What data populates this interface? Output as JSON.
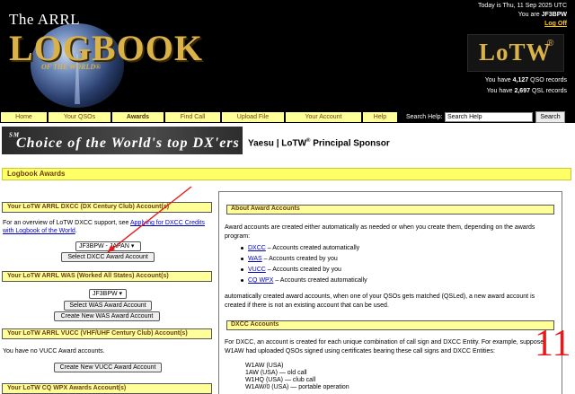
{
  "header": {
    "logo_line1": "The ARRL",
    "logo_line2": "LOGBOOK",
    "logo_line3": "OF THE WORLD®",
    "date_line": "Today is Thu, 11 Sep 2025 UTC",
    "you_are_prefix": "You are",
    "callsign": "JF3BPW",
    "logoff": "Log Off",
    "lotw_logo": "LoTW",
    "lotw_reg": "®",
    "qso_prefix": "You have",
    "qso_count": "4,127",
    "qso_suffix": "QSO records",
    "qsl_prefix": "You have",
    "qsl_count": "2,697",
    "qsl_suffix": "QSL records"
  },
  "nav": {
    "items": [
      "Home",
      "Your QSOs",
      "Awards",
      "Find Call",
      "Upload File",
      "Your Account",
      "Help"
    ],
    "search_label": "Search Help:",
    "search_value": "Search Help",
    "search_button": "Search"
  },
  "banner": {
    "tagline": "Choice of the World's top DX'ers",
    "tagline_sm": "SM",
    "sponsor_prefix": "Yaesu | LoTW",
    "sponsor_reg": "®",
    "sponsor_suffix": " Principal Sponsor"
  },
  "page": {
    "title": "Logbook Awards"
  },
  "left": {
    "dxcc_header": "Your LoTW ARRL DXCC (DX Century Club) Account(s)",
    "dxcc_text_prefix": "For an overview of LoTW DXCC support, see ",
    "dxcc_link": "Applying for DXCC Credits with Logbook of the World",
    "dxcc_text_suffix": ".",
    "dxcc_select": "JF3BPW - JAPAN ▾",
    "dxcc_button": "Select DXCC Award Account",
    "was_header": "Your LoTW ARRL WAS (Worked All States) Account(s)",
    "was_select": "JF3BPW ▾",
    "was_select_button": "Select WAS Award Account",
    "was_create_button": "Create New WAS Award Account",
    "vucc_header": "Your LoTW ARRL VUCC (VHF/UHF Century Club) Account(s)",
    "vucc_text": "You have no VUCC Award accounts.",
    "vucc_create_button": "Create New VUCC Award Account",
    "wpx_header": "Your LoTW CQ WPX Awards Account(s)"
  },
  "right": {
    "about_header": "About Award Accounts",
    "about_text": "Award accounts are created either automatically as needed or when you create them, depending on the awards program:",
    "list": [
      {
        "link": "DXCC",
        "text": " – Accounts created automatically"
      },
      {
        "link": "WAS",
        "text": " – Accounts created by you"
      },
      {
        "link": "VUCC",
        "text": " – Accounts created by you"
      },
      {
        "link": "CQ WPX",
        "text": " – Accounts created automatically"
      }
    ],
    "auto_text": "automatically created award accounts, when one of your QSOs gets matched (QSLed), a new award account is created if there is not an existing account that can be used.",
    "dxcc_header": "DXCC Accounts",
    "dxcc_text": "For DXCC, an account is created for each unique combination of call sign and DXCC Entity. For example, suppose W1AW had uploaded QSOs signed using certificates bearing these call signs and DXCC Entities:",
    "callsigns": [
      "W1AW (USA)",
      "1AW (USA) — old call",
      "W1HQ (USA) — club call",
      "W1AW/0 (USA) — portable operation"
    ]
  },
  "annotation": {
    "number": "11",
    "color": "#e61a1a"
  },
  "colors": {
    "nav_bg": "#ffff99",
    "section_bar": "#ffff66",
    "header_text": "#6b3e12",
    "link": "#0000cc"
  }
}
